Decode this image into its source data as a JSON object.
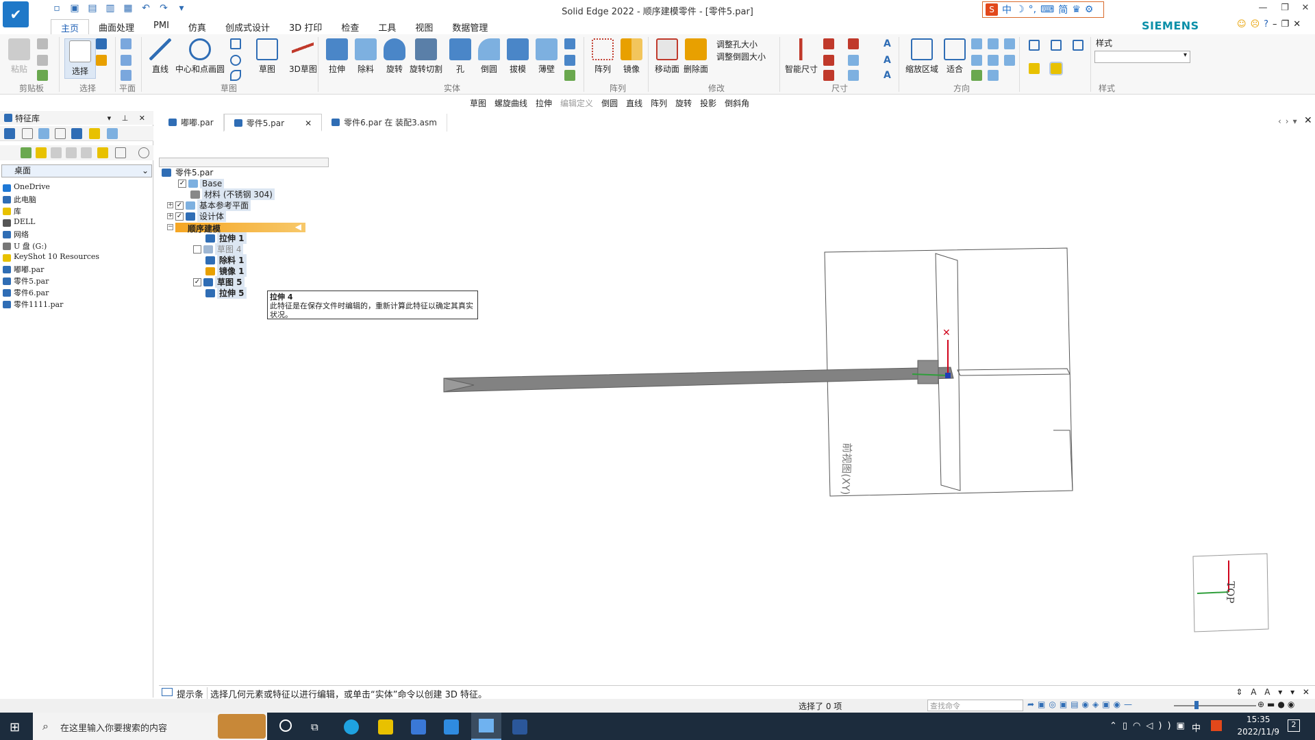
{
  "window": {
    "title": "Solid Edge 2022 - 顺序建模零件 - [零件5.par]",
    "brand": "SIEMENS"
  },
  "ime": {
    "label": "中",
    "items": [
      "中",
      "☽",
      "°",
      "⌨",
      "简",
      "👕",
      "⚙"
    ]
  },
  "ribbon": {
    "tabs": [
      "主页",
      "曲面处理",
      "PMI",
      "仿真",
      "创成式设计",
      "3D 打印",
      "检查",
      "工具",
      "视图",
      "数据管理"
    ],
    "groups": {
      "clipboard": "剪贴板",
      "select": "选择",
      "plane": "平面",
      "sketch": "草图",
      "solid": "实体",
      "array": "阵列",
      "modify": "修改",
      "dimension": "尺寸",
      "orient": "方向",
      "style": "样式"
    },
    "buttons": {
      "paste": "粘贴",
      "select": "选择",
      "line": "直线",
      "circle": "中心和点画圆",
      "sketch": "草图",
      "sketch3d": "3D草图",
      "extrude": "拉伸",
      "cut": "除料",
      "revolve": "旋转",
      "revolve_cut": "旋转切割",
      "hole": "孔",
      "round": "倒圆",
      "draft": "拔模",
      "thin_wall": "薄壁",
      "pattern": "阵列",
      "mirror": "镜像",
      "move_face": "移动面",
      "delete_face": "删除面",
      "resize_hole": "调整孔大小",
      "resize_round": "调整倒圆大小",
      "smart_dim": "智能尺寸",
      "zoom_area": "缩放区域",
      "fit": "适合",
      "style_label": "样式"
    }
  },
  "cmdbar": {
    "items": [
      "草图",
      "螺旋曲线",
      "拉伸",
      "编辑定义",
      "倒圆",
      "直线",
      "阵列",
      "旋转",
      "投影",
      "倒斜角"
    ]
  },
  "leftpanel": {
    "title": "特征库",
    "combo": "桌面",
    "files": [
      "OneDrive",
      "此电脑",
      "库",
      "DELL",
      "网络",
      "U 盘 (G:)",
      "KeyShot 10 Resources",
      "嘟嘟.par",
      "零件5.par",
      "零件6.par",
      "零件1111.par"
    ]
  },
  "doctabs": [
    "嘟嘟.par",
    "零件5.par",
    "零件6.par 在 装配3.asm"
  ],
  "tree": {
    "root": "零件5.par",
    "base": "Base",
    "material": "材料 (不锈钢 304)",
    "ref_planes": "基本参考平面",
    "design_body": "设计体",
    "seq_model": "顺序建模",
    "items": [
      "拉伸 1",
      "草图 4",
      "除料 1",
      "镜像 1",
      "草图 5",
      "拉伸 5"
    ]
  },
  "tooltip": {
    "title": "拉伸 4",
    "text": "此特征是在保存文件时编辑的，重新计算此特征以确定其真实状况。"
  },
  "viewport": {
    "plane_label": "前视图(XY)",
    "view_cube": "TOP"
  },
  "prompt": {
    "label": "提示条",
    "text": "选择几何元素或特征以进行编辑，或单击“实体”命令以创建 3D 特征。"
  },
  "status": {
    "selected": "选择了 0 项",
    "find_placeholder": "查找命令"
  },
  "taskbar": {
    "search": "在这里输入你要搜索的内容",
    "time": "15:35",
    "date": "2022/11/9",
    "ime": "中",
    "notif": "2"
  }
}
